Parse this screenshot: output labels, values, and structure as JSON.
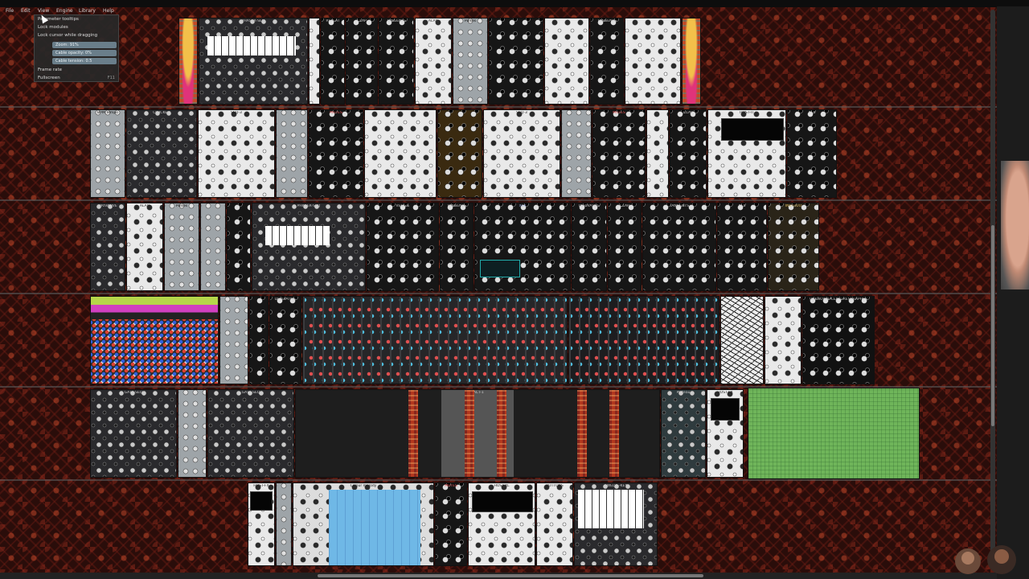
{
  "menubar": {
    "items": [
      "File",
      "Edit",
      "View",
      "Engine",
      "Library",
      "Help"
    ]
  },
  "view_menu": {
    "items": [
      "Parameter tooltips",
      "Lock modules",
      "Lock cursor while dragging"
    ],
    "sliders": [
      "Zoom: 91%",
      "Cable opacity: 0%",
      "Cable tension: 0.5"
    ],
    "frame_rate": "Frame rate",
    "fullscreen": "Fullscreen",
    "fullscreen_key": "F11"
  },
  "modules": {
    "r1": [
      "PHASER-SEQ",
      "REPEAT",
      "CLAP",
      "TANGENTS",
      "ALAN",
      "Pulses",
      "",
      "",
      "",
      "TANGENTS",
      "",
      ""
    ],
    "r2": [
      "BPM Tempo",
      "CLOCKED",
      "SEQ-3",
      "",
      "MUTES",
      "",
      "",
      "",
      "SEQ-3",
      "",
      "MUTES",
      "",
      "CLAP",
      "HOST-IT",
      "XFX"
    ],
    "r3": [
      "DRIVATIVE",
      "ALAN",
      "Pulses",
      "",
      "PHASER-SEQ",
      "VEGGIE",
      "TANGENTS",
      "XFX",
      "DERIVATIVE",
      "CLAP",
      "TANGENTS",
      "XFX",
      "INSTRUO"
    ],
    "r4": [
      "",
      "",
      "DERIVATIVE",
      "",
      "",
      "",
      "UNKNOWNPLEASURESGRAPHER"
    ],
    "r5": [
      "GATE-SEQ",
      "",
      "GATE-SEQ",
      "TACT-1",
      "Plateau",
      "HOST-FX",
      ""
    ],
    "r6": [
      "HOST-FX",
      "",
      "Colour melody",
      "MUTES",
      "HOST-XL",
      "BUTTONS",
      "TWELVE-KEY"
    ]
  }
}
